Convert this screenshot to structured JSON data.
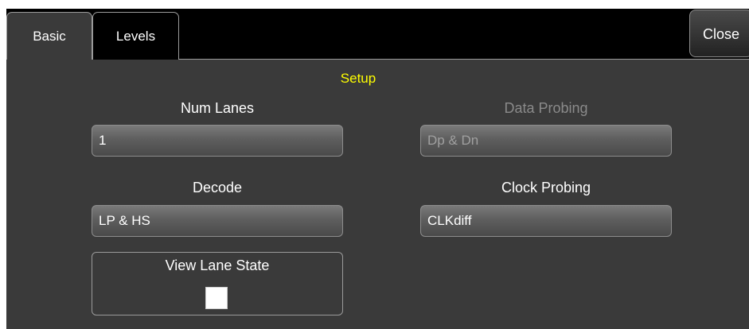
{
  "tabs": [
    {
      "label": "Basic",
      "active": true
    },
    {
      "label": "Levels",
      "active": false
    }
  ],
  "close_label": "Close",
  "section_title": "Setup",
  "num_lanes": {
    "label": "Num Lanes",
    "value": "1"
  },
  "data_probing": {
    "label": "Data Probing",
    "value": "Dp & Dn",
    "enabled": false
  },
  "decode": {
    "label": "Decode",
    "value": "LP & HS"
  },
  "clock_probing": {
    "label": "Clock Probing",
    "value": "CLKdiff"
  },
  "view_lane_state": {
    "label": "View Lane State",
    "checked": false
  },
  "colors": {
    "background": "#000000",
    "panel": "#3a3a3a",
    "section_title": "#ffff00",
    "disabled_text": "#8a8a8a"
  }
}
